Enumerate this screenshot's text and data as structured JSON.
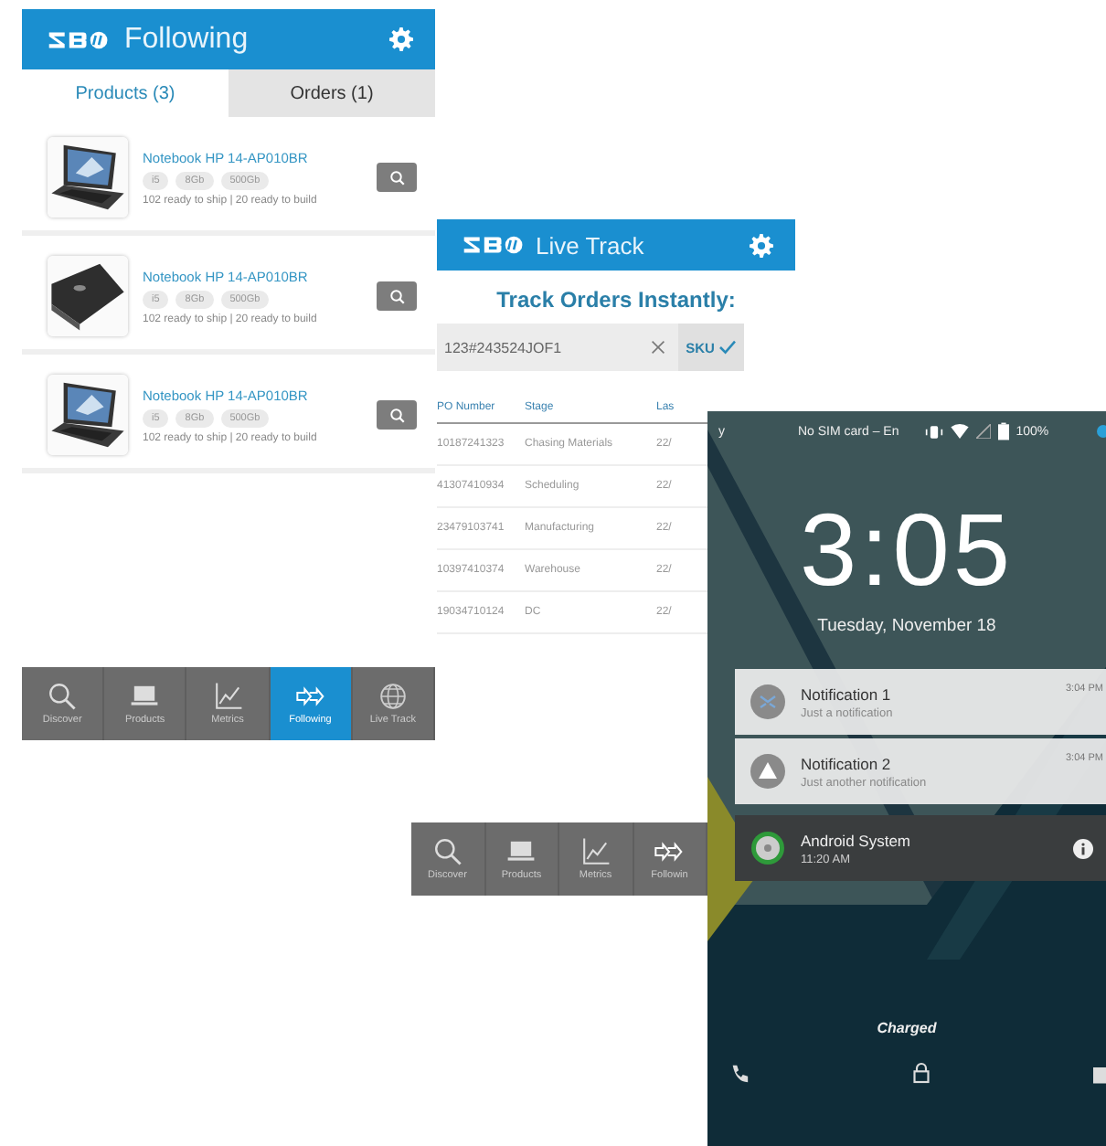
{
  "following_screen": {
    "title": "Following",
    "tabs": [
      {
        "label": "Products (3)",
        "selected": true
      },
      {
        "label": "Orders (1)",
        "selected": false
      }
    ],
    "products": [
      {
        "name": "Notebook HP 14-AP010BR",
        "specs": [
          "i5",
          "8Gb",
          "500Gb"
        ],
        "availability": "102 ready to ship | 20 ready to build"
      },
      {
        "name": "Notebook HP 14-AP010BR",
        "specs": [
          "i5",
          "8Gb",
          "500Gb"
        ],
        "availability": "102 ready to ship | 20 ready to build"
      },
      {
        "name": "Notebook HP 14-AP010BR",
        "specs": [
          "i5",
          "8Gb",
          "500Gb"
        ],
        "availability": "102 ready to ship | 20 ready to build"
      }
    ],
    "nav": [
      {
        "label": "Discover",
        "selected": false
      },
      {
        "label": "Products",
        "selected": false
      },
      {
        "label": "Metrics",
        "selected": false
      },
      {
        "label": "Following",
        "selected": true
      },
      {
        "label": "Live Track",
        "selected": false
      }
    ]
  },
  "live_track_screen": {
    "title": "Live Track",
    "heading": "Track Orders Instantly:",
    "search": {
      "value": "123#243524JOF1",
      "filter": "SKU"
    },
    "columns": [
      "PO Number",
      "Stage",
      "Las"
    ],
    "rows": [
      [
        "10187241323",
        "Chasing Materials",
        "22/"
      ],
      [
        "41307410934",
        "Scheduling",
        "22/"
      ],
      [
        "23479103741",
        "Manufacturing",
        "22/"
      ],
      [
        "10397410374",
        "Warehouse",
        "22/"
      ],
      [
        "19034710124",
        "DC",
        "22/"
      ]
    ],
    "nav": [
      {
        "label": "Discover",
        "selected": false
      },
      {
        "label": "Products",
        "selected": false
      },
      {
        "label": "Metrics",
        "selected": false
      },
      {
        "label": "Followin",
        "selected": false
      }
    ]
  },
  "lock_screen": {
    "status": {
      "edge_text": "y",
      "carrier": "No SIM card – En",
      "battery": "100%"
    },
    "time": "3:05",
    "date": "Tuesday, November 18",
    "notifications": [
      {
        "kind": "light",
        "title": "Notification 1",
        "text": "Just a notification",
        "time": "3:04 PM"
      },
      {
        "kind": "light",
        "title": "Notification 2",
        "text": "Just another notification",
        "time": "3:04 PM"
      },
      {
        "kind": "dark",
        "title": "Android System",
        "text": "11:20 AM"
      }
    ],
    "charging_status": "Charged"
  }
}
